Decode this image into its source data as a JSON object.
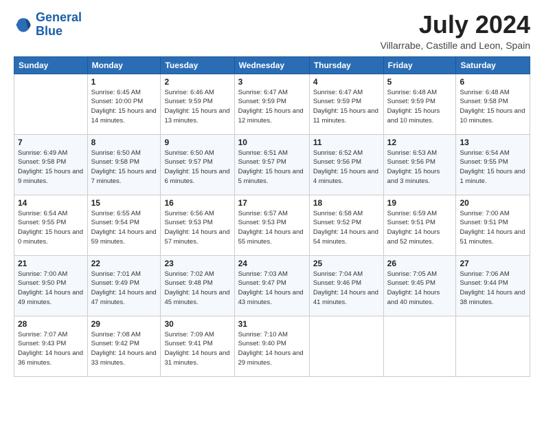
{
  "logo": {
    "line1": "General",
    "line2": "Blue"
  },
  "title": "July 2024",
  "subtitle": "Villarrabe, Castille and Leon, Spain",
  "weekdays": [
    "Sunday",
    "Monday",
    "Tuesday",
    "Wednesday",
    "Thursday",
    "Friday",
    "Saturday"
  ],
  "weeks": [
    [
      {
        "day": "",
        "sunrise": "",
        "sunset": "",
        "daylight": ""
      },
      {
        "day": "1",
        "sunrise": "Sunrise: 6:45 AM",
        "sunset": "Sunset: 10:00 PM",
        "daylight": "Daylight: 15 hours and 14 minutes."
      },
      {
        "day": "2",
        "sunrise": "Sunrise: 6:46 AM",
        "sunset": "Sunset: 9:59 PM",
        "daylight": "Daylight: 15 hours and 13 minutes."
      },
      {
        "day": "3",
        "sunrise": "Sunrise: 6:47 AM",
        "sunset": "Sunset: 9:59 PM",
        "daylight": "Daylight: 15 hours and 12 minutes."
      },
      {
        "day": "4",
        "sunrise": "Sunrise: 6:47 AM",
        "sunset": "Sunset: 9:59 PM",
        "daylight": "Daylight: 15 hours and 11 minutes."
      },
      {
        "day": "5",
        "sunrise": "Sunrise: 6:48 AM",
        "sunset": "Sunset: 9:59 PM",
        "daylight": "Daylight: 15 hours and 10 minutes."
      },
      {
        "day": "6",
        "sunrise": "Sunrise: 6:48 AM",
        "sunset": "Sunset: 9:58 PM",
        "daylight": "Daylight: 15 hours and 10 minutes."
      }
    ],
    [
      {
        "day": "7",
        "sunrise": "Sunrise: 6:49 AM",
        "sunset": "Sunset: 9:58 PM",
        "daylight": "Daylight: 15 hours and 9 minutes."
      },
      {
        "day": "8",
        "sunrise": "Sunrise: 6:50 AM",
        "sunset": "Sunset: 9:58 PM",
        "daylight": "Daylight: 15 hours and 7 minutes."
      },
      {
        "day": "9",
        "sunrise": "Sunrise: 6:50 AM",
        "sunset": "Sunset: 9:57 PM",
        "daylight": "Daylight: 15 hours and 6 minutes."
      },
      {
        "day": "10",
        "sunrise": "Sunrise: 6:51 AM",
        "sunset": "Sunset: 9:57 PM",
        "daylight": "Daylight: 15 hours and 5 minutes."
      },
      {
        "day": "11",
        "sunrise": "Sunrise: 6:52 AM",
        "sunset": "Sunset: 9:56 PM",
        "daylight": "Daylight: 15 hours and 4 minutes."
      },
      {
        "day": "12",
        "sunrise": "Sunrise: 6:53 AM",
        "sunset": "Sunset: 9:56 PM",
        "daylight": "Daylight: 15 hours and 3 minutes."
      },
      {
        "day": "13",
        "sunrise": "Sunrise: 6:54 AM",
        "sunset": "Sunset: 9:55 PM",
        "daylight": "Daylight: 15 hours and 1 minute."
      }
    ],
    [
      {
        "day": "14",
        "sunrise": "Sunrise: 6:54 AM",
        "sunset": "Sunset: 9:55 PM",
        "daylight": "Daylight: 15 hours and 0 minutes."
      },
      {
        "day": "15",
        "sunrise": "Sunrise: 6:55 AM",
        "sunset": "Sunset: 9:54 PM",
        "daylight": "Daylight: 14 hours and 59 minutes."
      },
      {
        "day": "16",
        "sunrise": "Sunrise: 6:56 AM",
        "sunset": "Sunset: 9:53 PM",
        "daylight": "Daylight: 14 hours and 57 minutes."
      },
      {
        "day": "17",
        "sunrise": "Sunrise: 6:57 AM",
        "sunset": "Sunset: 9:53 PM",
        "daylight": "Daylight: 14 hours and 55 minutes."
      },
      {
        "day": "18",
        "sunrise": "Sunrise: 6:58 AM",
        "sunset": "Sunset: 9:52 PM",
        "daylight": "Daylight: 14 hours and 54 minutes."
      },
      {
        "day": "19",
        "sunrise": "Sunrise: 6:59 AM",
        "sunset": "Sunset: 9:51 PM",
        "daylight": "Daylight: 14 hours and 52 minutes."
      },
      {
        "day": "20",
        "sunrise": "Sunrise: 7:00 AM",
        "sunset": "Sunset: 9:51 PM",
        "daylight": "Daylight: 14 hours and 51 minutes."
      }
    ],
    [
      {
        "day": "21",
        "sunrise": "Sunrise: 7:00 AM",
        "sunset": "Sunset: 9:50 PM",
        "daylight": "Daylight: 14 hours and 49 minutes."
      },
      {
        "day": "22",
        "sunrise": "Sunrise: 7:01 AM",
        "sunset": "Sunset: 9:49 PM",
        "daylight": "Daylight: 14 hours and 47 minutes."
      },
      {
        "day": "23",
        "sunrise": "Sunrise: 7:02 AM",
        "sunset": "Sunset: 9:48 PM",
        "daylight": "Daylight: 14 hours and 45 minutes."
      },
      {
        "day": "24",
        "sunrise": "Sunrise: 7:03 AM",
        "sunset": "Sunset: 9:47 PM",
        "daylight": "Daylight: 14 hours and 43 minutes."
      },
      {
        "day": "25",
        "sunrise": "Sunrise: 7:04 AM",
        "sunset": "Sunset: 9:46 PM",
        "daylight": "Daylight: 14 hours and 41 minutes."
      },
      {
        "day": "26",
        "sunrise": "Sunrise: 7:05 AM",
        "sunset": "Sunset: 9:45 PM",
        "daylight": "Daylight: 14 hours and 40 minutes."
      },
      {
        "day": "27",
        "sunrise": "Sunrise: 7:06 AM",
        "sunset": "Sunset: 9:44 PM",
        "daylight": "Daylight: 14 hours and 38 minutes."
      }
    ],
    [
      {
        "day": "28",
        "sunrise": "Sunrise: 7:07 AM",
        "sunset": "Sunset: 9:43 PM",
        "daylight": "Daylight: 14 hours and 36 minutes."
      },
      {
        "day": "29",
        "sunrise": "Sunrise: 7:08 AM",
        "sunset": "Sunset: 9:42 PM",
        "daylight": "Daylight: 14 hours and 33 minutes."
      },
      {
        "day": "30",
        "sunrise": "Sunrise: 7:09 AM",
        "sunset": "Sunset: 9:41 PM",
        "daylight": "Daylight: 14 hours and 31 minutes."
      },
      {
        "day": "31",
        "sunrise": "Sunrise: 7:10 AM",
        "sunset": "Sunset: 9:40 PM",
        "daylight": "Daylight: 14 hours and 29 minutes."
      },
      {
        "day": "",
        "sunrise": "",
        "sunset": "",
        "daylight": ""
      },
      {
        "day": "",
        "sunrise": "",
        "sunset": "",
        "daylight": ""
      },
      {
        "day": "",
        "sunrise": "",
        "sunset": "",
        "daylight": ""
      }
    ]
  ]
}
